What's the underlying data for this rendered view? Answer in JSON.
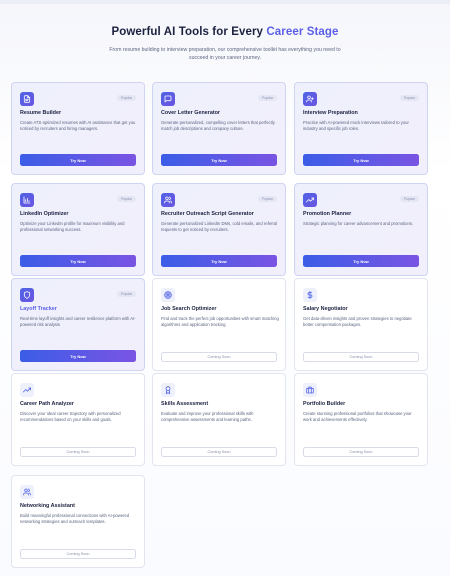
{
  "hero": {
    "title_main": "Powerful AI Tools for Every ",
    "title_accent": "Career Stage",
    "subtitle": "From resume building to interview preparation, our comprehensive toolkit has everything you need to succeed in your career journey."
  },
  "colors": {
    "accent": "#5b5fe6",
    "button_gradient_start": "#3b5de7",
    "button_gradient_end": "#7a54e3",
    "active_card_bg": "#eef0fc"
  },
  "tools": [
    {
      "title": "Resume Builder",
      "description": "Create ATS-optimized resumes with AI assistance that get you noticed by recruiters and hiring managers.",
      "badge": "Popular",
      "status": "available",
      "button": "Try Now",
      "icon": "document-icon"
    },
    {
      "title": "Cover Letter Generator",
      "description": "Generate personalized, compelling cover letters that perfectly match job descriptions and company culture.",
      "badge": "Popular",
      "status": "available",
      "button": "Try Now",
      "icon": "message-icon"
    },
    {
      "title": "Interview Preparation",
      "description": "Practice with AI-powered mock interviews tailored to your industry and specific job roles.",
      "badge": "Popular",
      "status": "available",
      "button": "Try Now",
      "icon": "user-plus-icon"
    },
    {
      "title": "LinkedIn Optimizer",
      "description": "Optimize your LinkedIn profile for maximum visibility and professional networking success.",
      "badge": "Popular",
      "status": "available",
      "button": "Try Now",
      "icon": "bar-chart-icon"
    },
    {
      "title": "Recruiter Outreach Script Generator",
      "description": "Generate personalized LinkedIn DMs, cold emails, and referral requests to get noticed by recruiters.",
      "badge": "Popular",
      "status": "available",
      "button": "Try Now",
      "icon": "users-icon"
    },
    {
      "title": "Promotion Planner",
      "description": "Strategic planning for career advancement and promotions.",
      "badge": "Popular",
      "status": "available",
      "button": "Try Now",
      "icon": "trending-up-icon"
    },
    {
      "title": "Layoff Tracker",
      "description": "Real-time layoff insights and career resilience platform with AI-powered risk analysis",
      "badge": "Popular",
      "status": "available",
      "button": "Try Now",
      "icon": "shield-icon"
    },
    {
      "title": "Job Search Optimizer",
      "description": "Find and track the perfect job opportunities with smart matching algorithms and application tracking.",
      "badge": "",
      "status": "coming_soon",
      "button": "Coming Soon",
      "icon": "target-icon"
    },
    {
      "title": "Salary Negotiator",
      "description": "Get data-driven insights and proven strategies to negotiate better compensation packages.",
      "badge": "",
      "status": "coming_soon",
      "button": "Coming Soon",
      "icon": "dollar-icon"
    },
    {
      "title": "Career Path Analyzer",
      "description": "Discover your ideal career trajectory with personalized recommendations based on your skills and goals.",
      "badge": "",
      "status": "coming_soon",
      "button": "Coming Soon",
      "icon": "trending-up-icon"
    },
    {
      "title": "Skills Assessment",
      "description": "Evaluate and improve your professional skills with comprehensive assessments and learning paths.",
      "badge": "",
      "status": "coming_soon",
      "button": "Coming Soon",
      "icon": "award-icon"
    },
    {
      "title": "Portfolio Builder",
      "description": "Create stunning professional portfolios that showcase your work and achievements effectively.",
      "badge": "",
      "status": "coming_soon",
      "button": "Coming Soon",
      "icon": "briefcase-icon"
    },
    {
      "title": "Networking Assistant",
      "description": "Build meaningful professional connections with AI-powered networking strategies and outreach templates.",
      "badge": "",
      "status": "coming_soon",
      "button": "Coming Soon",
      "icon": "users-icon"
    }
  ]
}
